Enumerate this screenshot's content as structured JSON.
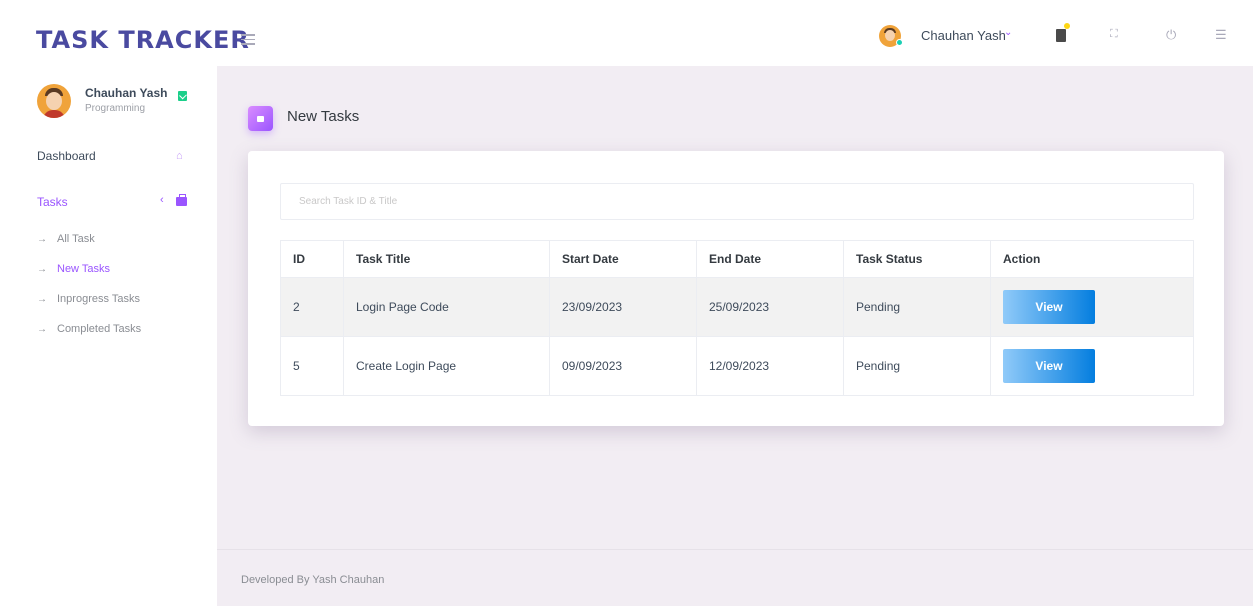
{
  "brand": "TASK TRACKER",
  "header": {
    "username": "Chauhan Yash",
    "icons": [
      "menu-icon",
      "avatar",
      "chevron-down-icon",
      "document-icon",
      "fullscreen-icon",
      "power-icon",
      "list-icon"
    ],
    "colors": {
      "accent": "#9a55ff",
      "online": "#1bcfb4",
      "notification": "#fed713"
    }
  },
  "sidebar": {
    "profile": {
      "name": "Chauhan Yash",
      "role": "Programming"
    },
    "items": [
      {
        "label": "Dashboard",
        "icon": "home-icon"
      },
      {
        "label": "Tasks",
        "icon": "briefcase-icon"
      }
    ],
    "submenu": [
      {
        "label": "All Task",
        "active": false
      },
      {
        "label": "New Tasks",
        "active": true
      },
      {
        "label": "Inprogress Tasks",
        "active": false
      },
      {
        "label": "Completed Tasks",
        "active": false
      }
    ]
  },
  "main": {
    "page_title": "New Tasks",
    "search": {
      "placeholder": "Search Task ID & Title",
      "value": ""
    },
    "table": {
      "headers": [
        "ID",
        "Task Title",
        "Start Date",
        "End Date",
        "Task Status",
        "Action"
      ],
      "rows": [
        {
          "id": "2",
          "title": "Login Page Code",
          "start": "23/09/2023",
          "end": "25/09/2023",
          "status": "Pending",
          "action": "View"
        },
        {
          "id": "5",
          "title": "Create Login Page",
          "start": "09/09/2023",
          "end": "12/09/2023",
          "status": "Pending",
          "action": "View"
        }
      ]
    }
  },
  "footer": {
    "text": "Developed By Yash Chauhan"
  }
}
